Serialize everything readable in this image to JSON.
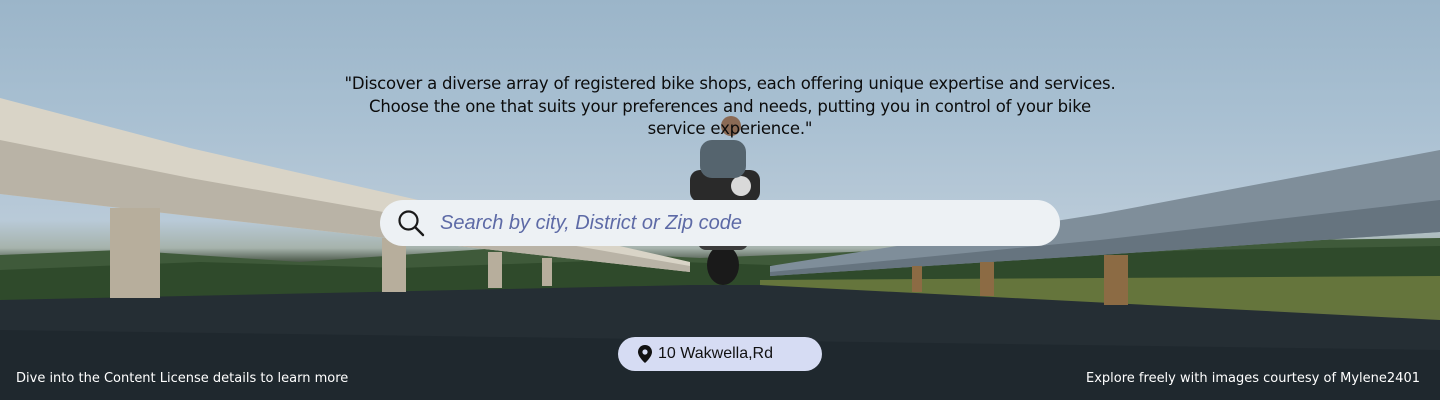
{
  "hero": {
    "quote": "\"Discover a diverse array of registered bike shops, each offering unique expertise and services. Choose the one that suits your preferences and needs, putting you in control of your bike service experience.\""
  },
  "search": {
    "placeholder": "Search by city, District or Zip code",
    "icon": "search-icon"
  },
  "location": {
    "icon": "map-pin-icon",
    "label": "10 Wakwella,Rd"
  },
  "footer": {
    "license_text": "Dive into the Content License details to learn more",
    "credit_text": "Explore freely with images courtesy of Mylene2401"
  }
}
